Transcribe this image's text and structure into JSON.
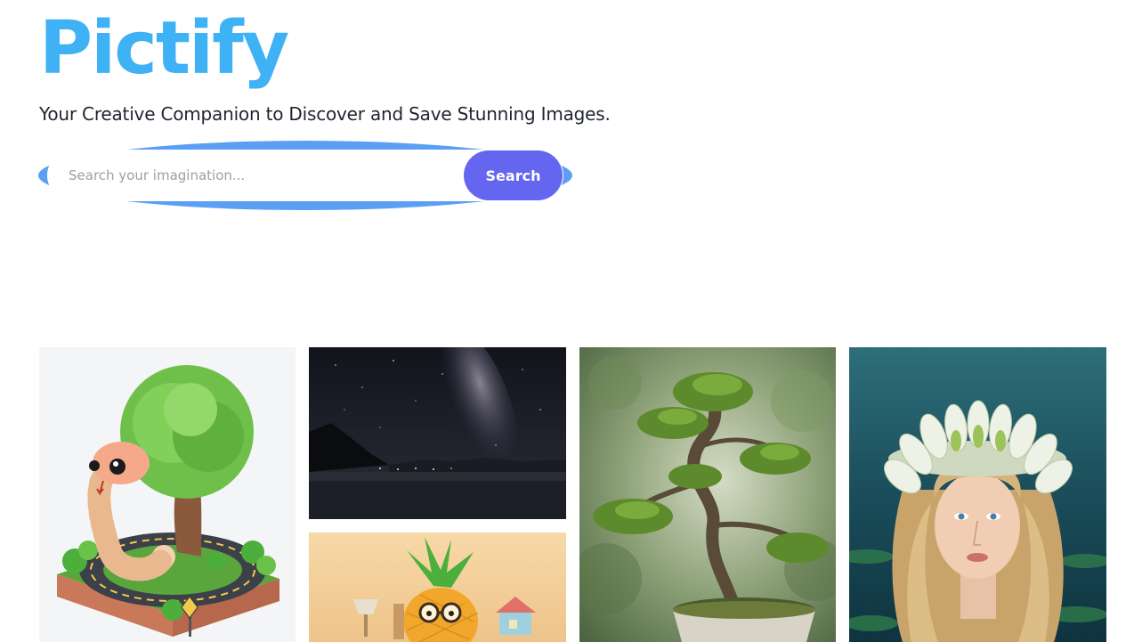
{
  "brand": {
    "name": "Pictify",
    "color": "#3fb2f5"
  },
  "tagline": "Your Creative Companion to Discover and Save Stunning Images.",
  "search": {
    "placeholder": "Search your imagination...",
    "value": "",
    "button_label": "Search",
    "button_color": "#6466f0",
    "outline_color": "#5b9ff4"
  },
  "gallery": {
    "images": [
      {
        "subject": "snake-and-tree-on-road-isometric"
      },
      {
        "subject": "milky-way-night-lake"
      },
      {
        "subject": "pineapple-character-with-glasses"
      },
      {
        "subject": "bonsai-tree-in-pot"
      },
      {
        "subject": "woman-with-water-lily-crown"
      }
    ]
  }
}
